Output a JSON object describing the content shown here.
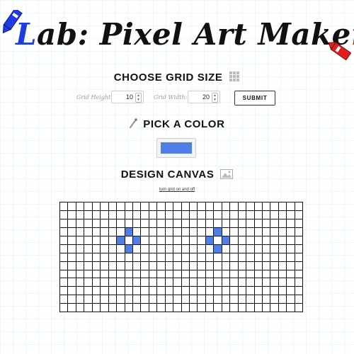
{
  "title": {
    "first_letter": "L",
    "middle": "ab: Pixel Art Make",
    "last_letter": "r"
  },
  "sections": {
    "grid_size": {
      "title": "CHOOSE GRID SIZE",
      "icon": "grid-icon"
    },
    "color": {
      "title": "PICK A COLOR",
      "icon": "eyedropper-icon"
    },
    "canvas": {
      "title": "DESIGN CANVAS",
      "icon": "image-icon"
    }
  },
  "controls": {
    "height_label": "Grid Height:",
    "height_value": "10",
    "width_label": "Grid Width:",
    "width_value": "20",
    "submit_label": "SUBMIT"
  },
  "color": {
    "selected": "#4f7fe4"
  },
  "canvas": {
    "toggle_label": "turn grid on and off",
    "rows": 13,
    "cols": 30,
    "painted_color": "#4f7fe4",
    "painted_cells": [
      {
        "row": 3,
        "col": 8
      },
      {
        "row": 4,
        "col": 7
      },
      {
        "row": 4,
        "col": 9
      },
      {
        "row": 5,
        "col": 8
      },
      {
        "row": 3,
        "col": 19
      },
      {
        "row": 4,
        "col": 18
      },
      {
        "row": 4,
        "col": 20
      },
      {
        "row": 5,
        "col": 19
      }
    ]
  },
  "colors": {
    "blue_crayon": "#1f3ce0",
    "red_crayon": "#e02020"
  }
}
